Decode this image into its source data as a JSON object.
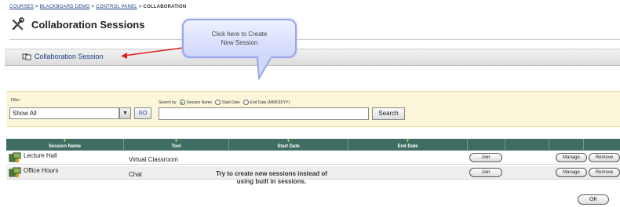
{
  "breadcrumb": {
    "items": [
      "COURSES",
      "BLACKBOARD DEMO",
      "CONTROL PANEL"
    ],
    "current": "COLLABORATION",
    "separator": ">"
  },
  "page": {
    "title": "Collaboration Sessions",
    "title_icon": "tools-icon"
  },
  "action_bar": {
    "link_label": "Collaboration Session",
    "link_icon": "new-session-icon"
  },
  "callout": {
    "text": "Click here to Create New Session"
  },
  "filter": {
    "label": "Filter",
    "selected": "Show All",
    "go_label": "GO",
    "search_by_label": "Search by",
    "options": [
      "Session Name",
      "Start Date",
      "End Date (MM/DD/YY)"
    ],
    "search_value": "",
    "search_button": "Search"
  },
  "table": {
    "columns": [
      "Session Name",
      "Tool",
      "Start Date",
      "End Date"
    ],
    "rows": [
      {
        "name": "Lecture Hall",
        "tool": "Virtual Classroom",
        "join": "Join",
        "manage": "Manage",
        "remove": "Remove"
      },
      {
        "name": "Office Hours",
        "tool": "Chat",
        "join": "Join",
        "manage": "Manage",
        "remove": "Remove"
      }
    ]
  },
  "annotation": {
    "text": "Try to create new sessions instead of using built in sessions."
  },
  "footer": {
    "ok_label": "OK"
  },
  "colors": {
    "link": "#1a3e84",
    "table_header": "#3f6d64",
    "filter_bg": "#fbf6d9",
    "callout_border": "#9aa6e8",
    "arrow": "#e02020"
  }
}
